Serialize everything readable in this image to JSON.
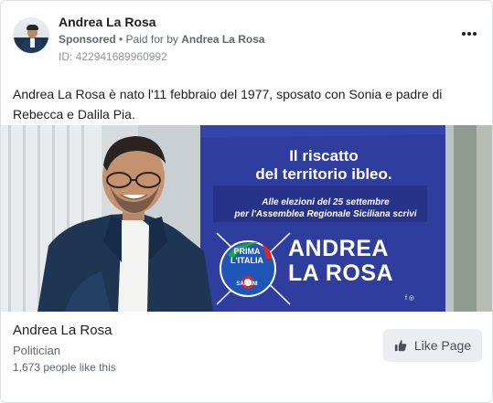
{
  "header": {
    "page_name": "Andrea La Rosa",
    "sponsored": "Sponsored",
    "separator": " • ",
    "paid_for_prefix": "Paid for by ",
    "paid_for_by": "Andrea La Rosa",
    "ad_id": "ID: 422941689960992",
    "more_icon": "more-horizontal-icon"
  },
  "post": {
    "text": "Andrea La Rosa è nato l'11 febbraio del 1977, sposato con Sonia e padre di Rebecca e Dalila Pia."
  },
  "creative": {
    "headline_line1": "Il riscatto",
    "headline_line2": "del territorio ibleo.",
    "sub_line1": "Alle elezioni del 25 settembre",
    "sub_line2": "per l'Assemblea Regionale Siciliana scrivi",
    "candidate_line1": "ANDREA",
    "candidate_line2": "LA ROSA",
    "logo_top": "PRIMA L'ITALIA",
    "logo_bottom": "SALVINI",
    "social_icons": "f ◎",
    "colors": {
      "panel_blue": "#2f3d9e",
      "panel_dark": "#263388",
      "logo_blue": "#1f56b7",
      "accent_green": "#1aa34a",
      "accent_red": "#d8262e"
    }
  },
  "footer": {
    "page_name": "Andrea La Rosa",
    "category": "Politician",
    "likes": "1,673 people like this",
    "like_button_label": "Like Page",
    "like_icon": "thumbs-up-icon"
  }
}
